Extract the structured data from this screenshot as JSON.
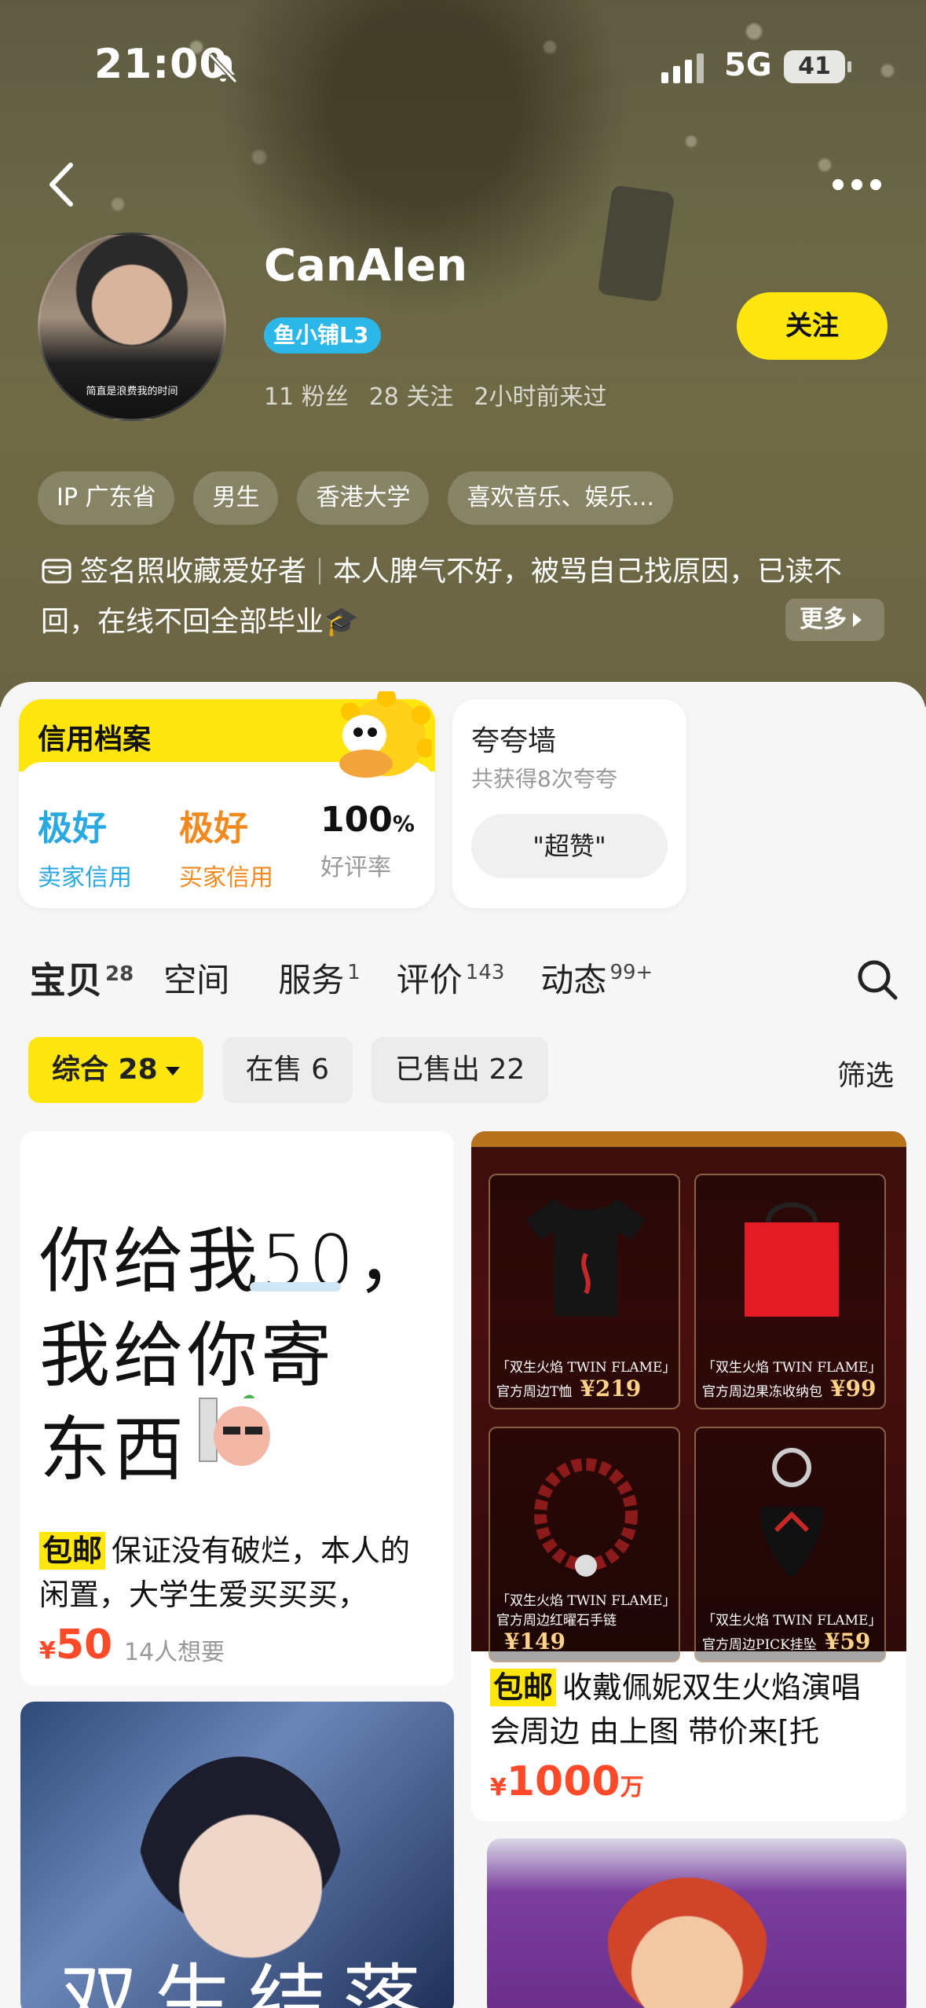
{
  "status_bar": {
    "time": "21:00",
    "network": "5G",
    "battery": "41"
  },
  "profile": {
    "avatar_caption": "简直是浪费我的时间",
    "name": "CanAlen",
    "badge": "鱼小铺L3",
    "stats": {
      "fans": "11 粉丝",
      "following": "28 关注",
      "last_seen": "2小时前来过"
    },
    "follow_label": "关注",
    "tags": [
      "IP 广东省",
      "男生",
      "香港大学",
      "喜欢音乐、娱乐..."
    ],
    "bio_part1": "签名照收藏爱好者",
    "bio_part2": "本人脾气不好，被骂自己找原因，已读不回，在线不回全部毕业🎓",
    "more_label": "更多"
  },
  "credit": {
    "title": "信用档案",
    "seller_value": "极好",
    "seller_label": "卖家信用",
    "buyer_value": "极好",
    "buyer_label": "买家信用",
    "rate_value": "100",
    "rate_unit": "%",
    "rate_label": "好评率"
  },
  "praise": {
    "title": "夸夸墙",
    "subtitle": "共获得8次夸夸",
    "pill": "\"超赞\""
  },
  "tabs": [
    {
      "label": "宝贝",
      "count": "28"
    },
    {
      "label": "空间",
      "count": ""
    },
    {
      "label": "服务",
      "count": "1"
    },
    {
      "label": "评价",
      "count": "143"
    },
    {
      "label": "动态",
      "count": "99+"
    }
  ],
  "filters": {
    "all": "综合 28",
    "on_sale": "在售 6",
    "sold": "已售出 22",
    "filter_link": "筛选"
  },
  "items": [
    {
      "image_lines": [
        "你给我50，",
        "我给你寄",
        "东西"
      ],
      "tag": "包邮",
      "title": "保证没有破烂，本人的闲置，大学生爱买买买，",
      "currency": "¥",
      "price": "50",
      "want": "14人想要"
    },
    {
      "image_caption_1": "「双生火焰 TWIN FLAME」官方周边T恤",
      "image_price_1": "¥219",
      "image_caption_2": "「双生火焰 TWIN FLAME」官方周边果冻收纳包",
      "image_price_2": "¥99",
      "image_caption_3": "「双生火焰 TWIN FLAME」官方周边红曜石手链",
      "image_price_3": "¥149",
      "image_caption_4": "「双生火焰 TWIN FLAME」官方周边PICK挂坠",
      "image_price_4": "¥59",
      "tag": "包邮",
      "title": "收戴佩妮双生火焰演唱会周边 由上图 带价来[托",
      "currency": "¥",
      "price": "1000",
      "unit": "万"
    },
    {
      "image_text": "双生结落"
    },
    {
      "image_text": ""
    }
  ],
  "colors": {
    "accent": "#ffe60f",
    "price": "#ff4a2a",
    "seller": "#2aa8e0",
    "buyer": "#f08a1e",
    "badge": "#2bb7e8"
  }
}
